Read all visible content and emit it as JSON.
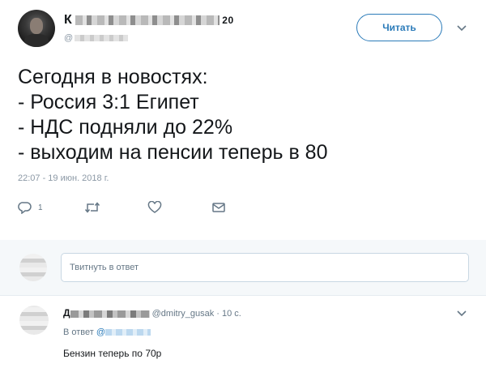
{
  "tweet": {
    "name_first_letter": "К",
    "name_tail": "20",
    "handle_prefix": "@",
    "follow_label": "Читать",
    "text_lines": [
      "Сегодня в новостях:",
      "- Россия 3:1 Египет",
      "- НДС подняли до 22%",
      "- выходим на пенсии теперь в 80"
    ],
    "timestamp": "22:07 - 19 июн. 2018 г.",
    "actions": {
      "reply_count": "1",
      "retweet_count": "",
      "like_count": ""
    }
  },
  "reply_box": {
    "placeholder": "Твитнуть в ответ"
  },
  "reply": {
    "name_first_letter": "Д",
    "handle": "@dmitry_gusak",
    "time": "· 10 с.",
    "reply_to_label": "В ответ",
    "reply_to_at": "@",
    "text": "Бензин теперь по 70р"
  },
  "colors": {
    "accent": "#2b7bb9",
    "muted": "#657786",
    "reply_bar_bg": "#f5f8fa"
  }
}
